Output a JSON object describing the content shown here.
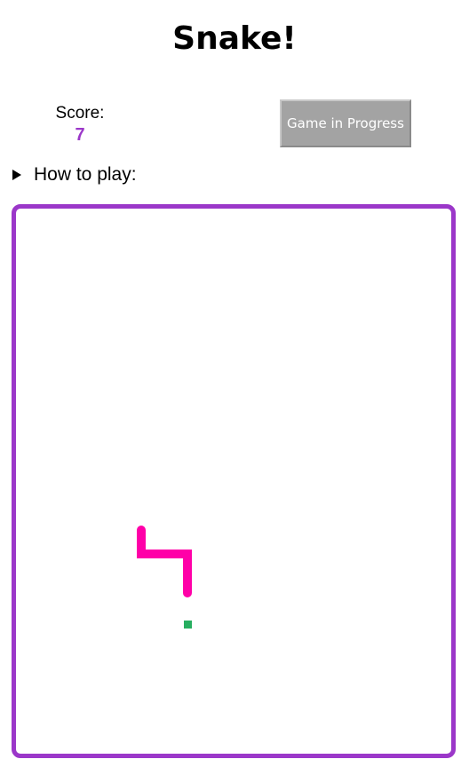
{
  "title": "Snake!",
  "score": {
    "label": "Score:",
    "value": "7"
  },
  "status_button": {
    "label": "Game in Progress"
  },
  "how_to_play": {
    "label": "How to play:",
    "expanded": false
  },
  "colors": {
    "board_border": "#9b37c9",
    "score_value": "#9b37c9",
    "snake": "#ff00a8",
    "food": "#27ae60",
    "button_bg": "#a3a3a3"
  }
}
